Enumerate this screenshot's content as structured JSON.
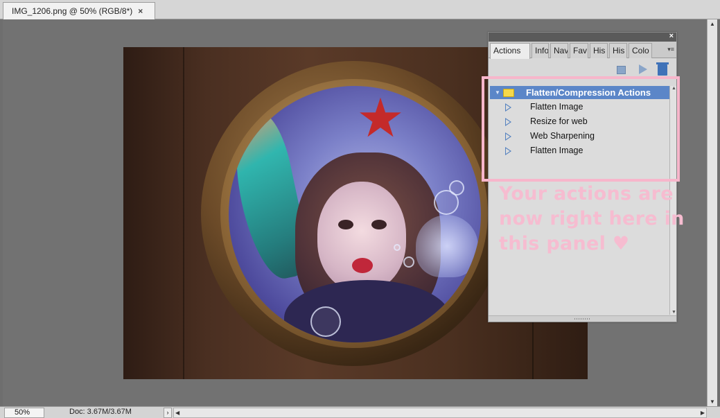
{
  "document_tab": {
    "title": "IMG_1206.png @ 50% (RGB/8*)",
    "close_glyph": "×"
  },
  "status_bar": {
    "zoom": "50%",
    "doc_info": "Doc: 3.67M/3.67M",
    "arrow_glyph": "›"
  },
  "panel": {
    "close_glyph": "×",
    "menu_icon": "panel-menu-icon",
    "tabs": [
      {
        "label": "Actions",
        "active": true
      },
      {
        "label": "Info",
        "active": false
      },
      {
        "label": "Nav",
        "active": false
      },
      {
        "label": "Fav",
        "active": false
      },
      {
        "label": "His",
        "active": false
      },
      {
        "label": "His",
        "active": false
      },
      {
        "label": "Colo",
        "active": false
      }
    ],
    "toolbar": {
      "stop_icon": "stop-icon",
      "play_icon": "play-icon",
      "trash_icon": "trash-icon"
    },
    "action_set": {
      "label": "Flatten/Compression Actions",
      "icon": "folder-icon"
    },
    "actions": [
      {
        "label": "Flatten Image"
      },
      {
        "label": "Resize for web"
      },
      {
        "label": "Web Sharpening"
      },
      {
        "label": "Flatten Image"
      }
    ]
  },
  "annotation": {
    "text": "Your actions are now right here in this panel",
    "heart": "♥",
    "color": "#f6bcd0"
  },
  "colors": {
    "selection": "#5b86c8",
    "highlight_box": "#f7b6cb",
    "workspace": "#727272"
  }
}
